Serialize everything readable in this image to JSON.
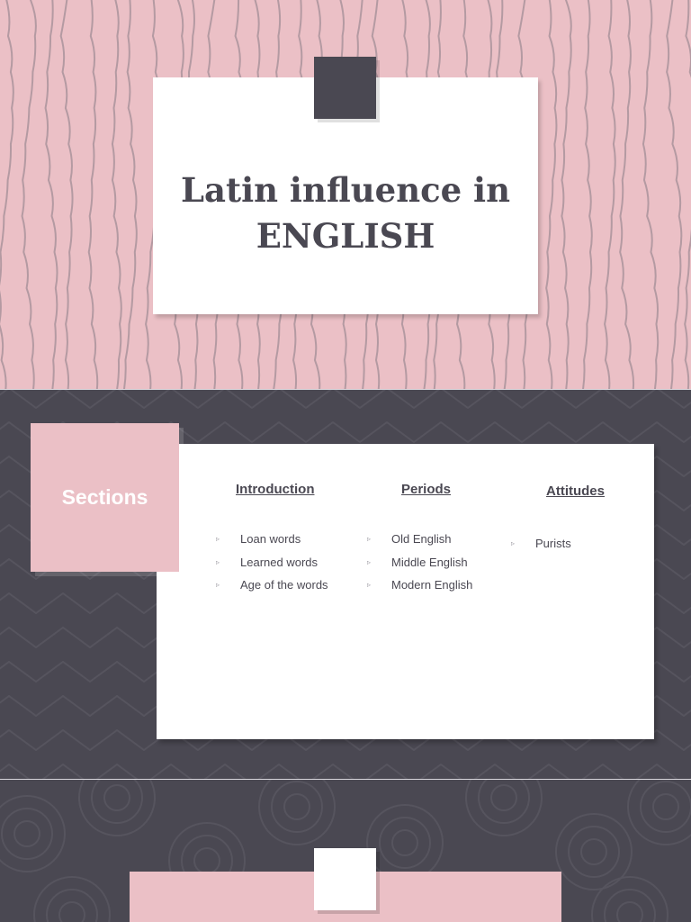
{
  "slide1": {
    "title_line1": "Latin influence in",
    "title_line2": "ENGLISH"
  },
  "slide2": {
    "sections_label": "Sections",
    "columns": [
      {
        "heading": "Introduction",
        "items": [
          "Loan words",
          "Learned words",
          "Age of the words"
        ]
      },
      {
        "heading": "Periods",
        "items": [
          "Old English",
          "Middle English",
          "Modern English"
        ]
      },
      {
        "heading": "Attitudes",
        "items": [
          "Purists"
        ]
      }
    ],
    "bullet_glyph": "▹"
  },
  "colors": {
    "pink": "#ebc0c6",
    "dark": "#4a4852",
    "white": "#ffffff",
    "wood_line": "#b49aa2"
  }
}
